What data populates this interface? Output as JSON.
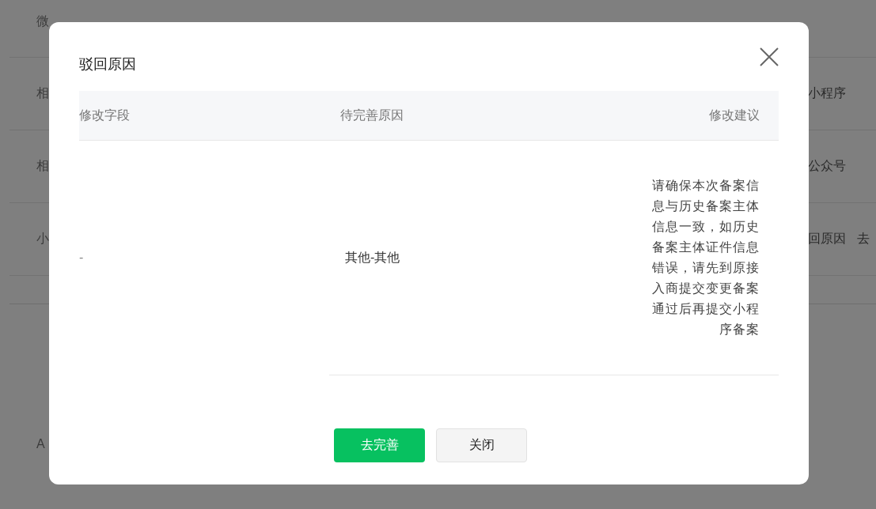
{
  "background": {
    "rows": [
      {
        "label": "微"
      },
      {
        "label": "相",
        "value": "小程序"
      },
      {
        "label": "相",
        "value": "公众号"
      },
      {
        "label": "小",
        "value": "回原因",
        "action": "去"
      }
    ],
    "section_rows": [
      {
        "label": "A"
      }
    ]
  },
  "dialog": {
    "title": "驳回原因",
    "table": {
      "columns": [
        "修改字段",
        "待完善原因",
        "修改建议"
      ],
      "rows": [
        [
          "-",
          "其他-其他",
          "请确保本次备案信息与历史备案主体信息一致，如历史备案主体证件信息错误，请先到原接入商提交变更备案通过后再提交小程序备案"
        ]
      ]
    },
    "buttons": [
      {
        "label": "去完善",
        "kind": "primary"
      },
      {
        "label": "关闭",
        "kind": "default"
      }
    ]
  }
}
